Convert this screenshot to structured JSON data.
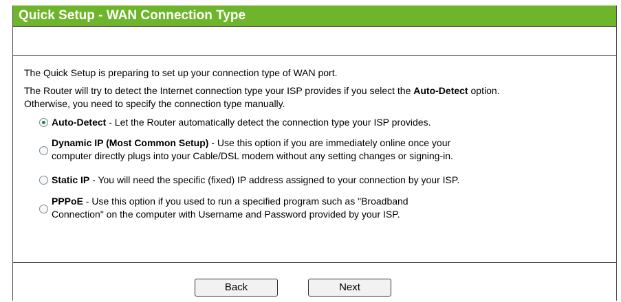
{
  "header": {
    "title": "Quick Setup - WAN Connection Type"
  },
  "intro": {
    "line1": "The Quick Setup is preparing to set up your connection type of WAN port.",
    "line2_pre": "The Router will try to detect the Internet connection type your ISP provides if you select the ",
    "line2_bold": "Auto-Detect",
    "line2_post": " option.",
    "line3": "Otherwise, you need to specify the connection type manually."
  },
  "options": [
    {
      "label": "Auto-Detect",
      "desc_line1": " - Let the Router automatically detect the connection type your ISP provides.",
      "desc_line2": "",
      "selected": true
    },
    {
      "label": "Dynamic IP (Most Common Setup)",
      "desc_line1": " - Use this option if you are immediately online once your",
      "desc_line2": "computer directly plugs into your Cable/DSL modem without any setting changes or signing-in.",
      "selected": false
    },
    {
      "label": "Static IP",
      "desc_line1": " - You will need the specific (fixed) IP address assigned to your connection by your ISP.",
      "desc_line2": "",
      "selected": false
    },
    {
      "label": "PPPoE",
      "desc_line1": " - Use this option if you used to run a specified program such as \"Broadband",
      "desc_line2": "Connection\" on the computer with Username and Password provided by your ISP.",
      "selected": false
    }
  ],
  "buttons": {
    "back": "Back",
    "next": "Next"
  },
  "colors": {
    "header_bg": "#6fb52c",
    "border": "#4a4a4a"
  }
}
